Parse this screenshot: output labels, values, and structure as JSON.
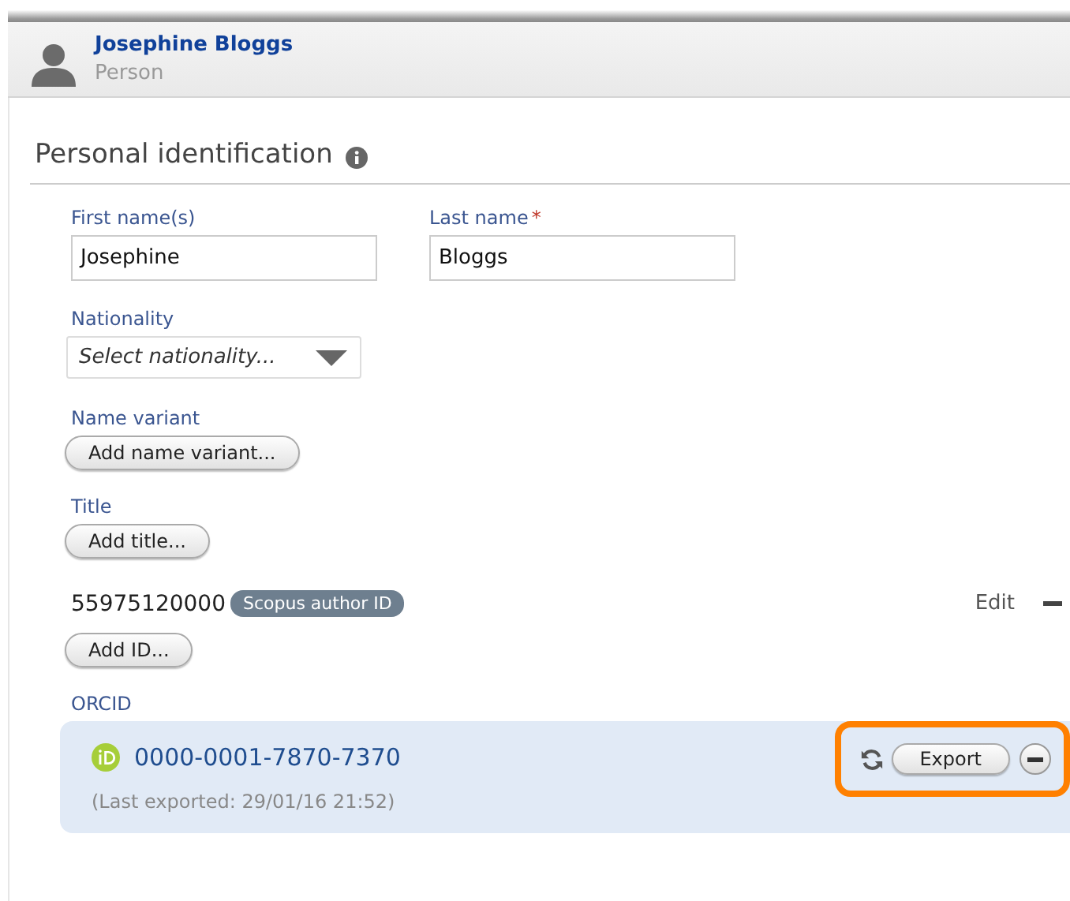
{
  "header": {
    "name": "Josephine Bloggs",
    "type": "Person"
  },
  "section": {
    "title": "Personal identification"
  },
  "name_fields": [
    {
      "label": "First name(s)",
      "value": "Josephine"
    },
    {
      "label": "Last name",
      "value": "Bloggs",
      "required_mark": "*"
    }
  ],
  "nationality": {
    "label": "Nationality",
    "placeholder": "Select nationality..."
  },
  "name_variant": {
    "label": "Name variant",
    "button": "Add name variant..."
  },
  "title": {
    "label": "Title",
    "button": "Add title..."
  },
  "ids": [
    {
      "value": "55975120000",
      "type": "Scopus author ID",
      "edit": "Edit"
    }
  ],
  "add_id": {
    "button": "Add ID..."
  },
  "orcid": {
    "label": "ORCID",
    "number": "0000-0001-7870-7370",
    "last_exported": "(Last exported: 29/01/16 21:52)",
    "export_button": "Export",
    "highlighted": true
  }
}
